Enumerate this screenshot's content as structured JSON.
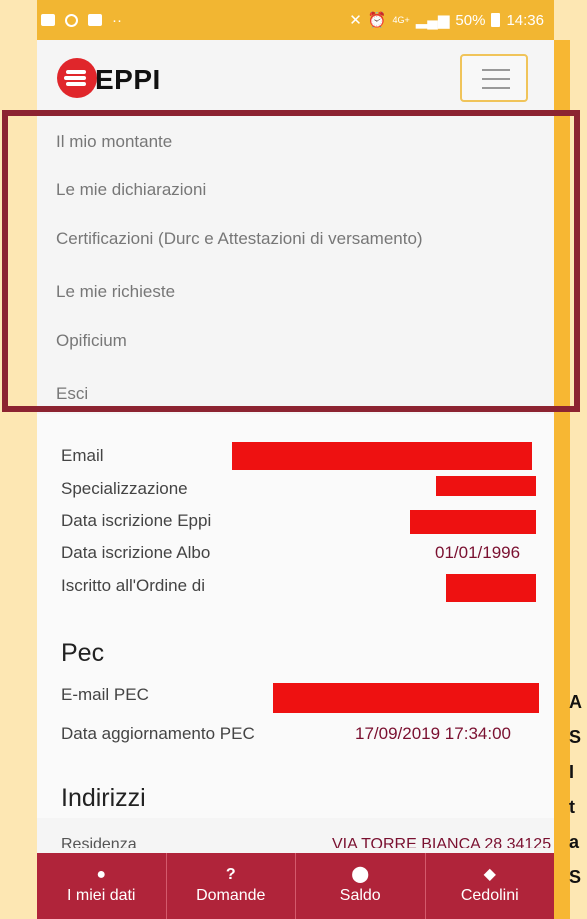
{
  "status_bar": {
    "signal_label": "4G+",
    "battery": "50%",
    "time": "14:36"
  },
  "header": {
    "logo_text": "EPPI",
    "menu_icon": "hamburger-icon"
  },
  "menu": {
    "items": [
      {
        "label": "Il mio montante"
      },
      {
        "label": "Le mie dichiarazioni"
      },
      {
        "label": "Certificazioni (Durc e Attestazioni di versamento)"
      },
      {
        "label": "Le mie richieste"
      },
      {
        "label": "Opificium"
      },
      {
        "label": "Esci"
      }
    ]
  },
  "profile": {
    "email_label": "Email",
    "specializzazione_label": "Specializzazione",
    "data_iscrizione_eppi_label": "Data iscrizione Eppi",
    "data_iscrizione_albo_label": "Data iscrizione Albo",
    "data_iscrizione_albo_value": "01/01/1996",
    "ordine_label": "Iscritto all'Ordine di"
  },
  "pec": {
    "title": "Pec",
    "email_label": "E-mail PEC",
    "updated_label": "Data aggiornamento PEC",
    "updated_value": "17/09/2019 17:34:00"
  },
  "indirizzi": {
    "title": "Indirizzi",
    "residenza_label": "Residenza",
    "residenza_value": "VIA TORRE BIANCA 28 34125"
  },
  "bottom_nav": [
    {
      "label": "I miei dati",
      "icon": "user-icon"
    },
    {
      "label": "Domande",
      "icon": "question-icon"
    },
    {
      "label": "Saldo",
      "icon": "map-pin-icon"
    },
    {
      "label": "Cedolini",
      "icon": "piggy-bank-icon"
    }
  ],
  "side_text": [
    "A",
    "S",
    "I",
    "t",
    "a",
    "S"
  ],
  "colors": {
    "accent": "#f2b632",
    "brand_red": "#e0262b",
    "nav_bg": "#b0243a",
    "highlight_border": "#8c2331",
    "redaction": "#ee1111"
  }
}
